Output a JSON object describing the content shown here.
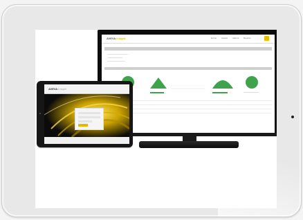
{
  "tv_app": {
    "logo_main": "AVEVA",
    "logo_accent": "Insight",
    "nav": [
      "Home",
      "Assets",
      "Alarms",
      "Reports"
    ]
  },
  "tablet_app": {
    "logo_main": "AVEVA",
    "logo_accent": "Insight"
  },
  "colors": {
    "accent_yellow": "#e8c000",
    "chart_green": "#3fa34d"
  }
}
